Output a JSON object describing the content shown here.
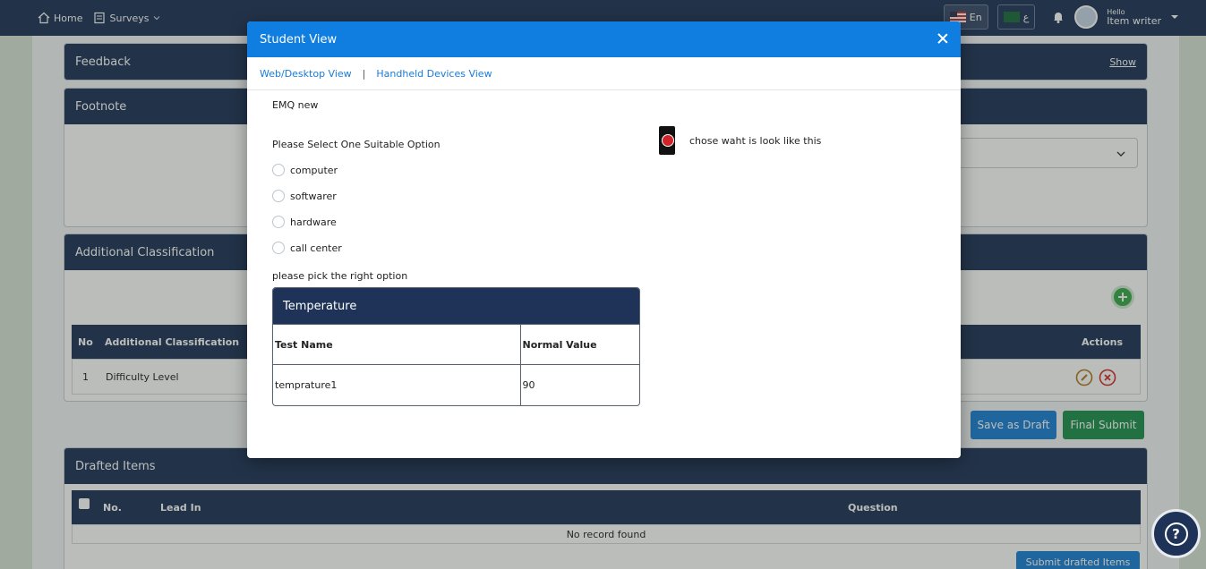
{
  "topbar": {
    "home_label": "Home",
    "surveys_label": "Surveys",
    "lang_en": "En",
    "lang_ar": "ع",
    "greeting": "Hello",
    "user_role": "Item writer"
  },
  "background": {
    "feedback_title": "Feedback",
    "feedback_show": "Show",
    "footnote_title": "Footnote",
    "classification_title": "Additional Classification",
    "classification_columns": [
      "No",
      "Additional Classification",
      "Actions"
    ],
    "classification_row": {
      "no": "1",
      "name": "Difficulty Level"
    },
    "save_draft_label": "Save as Draft",
    "final_submit_label": "Final Submit",
    "drafted_title": "Drafted Items",
    "drafted_columns": [
      "No.",
      "Lead In",
      "Question"
    ],
    "no_record": "No record found",
    "submit_drafted_label": "Submit drafted Items"
  },
  "modal": {
    "title": "Student View",
    "tab_web": "Web/Desktop View",
    "tab_separator": "|",
    "tab_handheld": "Handheld Devices View",
    "lead_in": "EMQ new",
    "question1": "Please Select One Suitable Option",
    "options": [
      "computer",
      "softwarer",
      "hardware",
      "call center"
    ],
    "question2": "please pick the right option",
    "table": {
      "title": "Temperature",
      "headers": [
        "Test Name",
        "Normal Value"
      ],
      "rows": [
        [
          "temprature1",
          "90"
        ]
      ]
    },
    "media_caption": "chose waht is look like this"
  },
  "colors": {
    "navy": "#1f3358",
    "modal_header": "#0f7ee0",
    "link": "#1a7bd8",
    "save_draft": "#1d7fd6",
    "final_submit": "#1f8f4f"
  },
  "icons": [
    "home-icon",
    "surveys-icon",
    "chevron-down-icon",
    "bell-icon",
    "close-icon",
    "play-icon",
    "help-icon",
    "plus-icon",
    "edit-icon",
    "delete-icon"
  ]
}
